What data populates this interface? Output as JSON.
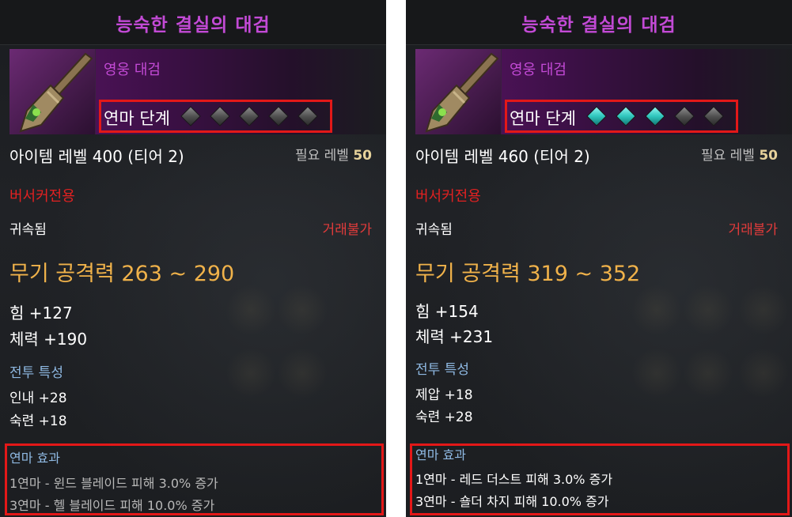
{
  "panels": [
    {
      "item_name": "능숙한 결실의 대검",
      "grade": "영웅 대검",
      "refine_label": "연마 단계",
      "gems": [
        "inactive",
        "inactive",
        "inactive",
        "inactive",
        "inactive"
      ],
      "item_level": "아이템 레벨 400 (티어 2)",
      "required_level_label": "필요 레벨",
      "required_level_value": "50",
      "class_restrict": "버서커전용",
      "bound": "귀속됨",
      "trade": "거래불가",
      "attack": "무기 공격력 263 ~ 290",
      "stats": [
        "힘 +127",
        "체력 +190"
      ],
      "combat_title": "전투 특성",
      "combat_stats": [
        "인내 +28",
        "숙련 +18"
      ],
      "effect_title": "연마 효과",
      "effects": [
        "1연마 - 윈드 블레이드 피해 3.0% 증가",
        "3연마 - 헬 블레이드 피해 10.0% 증가"
      ],
      "effect_color": "#b8b8b8"
    },
    {
      "item_name": "능숙한 결실의 대검",
      "grade": "영웅 대검",
      "refine_label": "연마 단계",
      "gems": [
        "active",
        "active",
        "active",
        "inactive",
        "inactive"
      ],
      "item_level": "아이템 레벨 460 (티어 2)",
      "required_level_label": "필요 레벨",
      "required_level_value": "50",
      "class_restrict": "버서커전용",
      "bound": "귀속됨",
      "trade": "거래불가",
      "attack": "무기 공격력 319 ~ 352",
      "stats": [
        "힘 +154",
        "체력 +231"
      ],
      "combat_title": "전투 특성",
      "combat_stats": [
        "제압 +18",
        "숙련 +28"
      ],
      "effect_title": "연마 효과",
      "effects": [
        "1연마 - 레드 더스트 피해 3.0% 증가",
        "3연마 - 숄더 차지 피해 10.0% 증가"
      ],
      "effect_color": "#ffffff"
    }
  ],
  "colors": {
    "item_name": "#c34ad6",
    "attack": "#f0b24a",
    "section": "#8fb9e3",
    "class_restrict": "#e12121",
    "highlight_box": "#e31818",
    "gem_active": "#2fc6bd",
    "gem_inactive": "#6a6a6a"
  }
}
